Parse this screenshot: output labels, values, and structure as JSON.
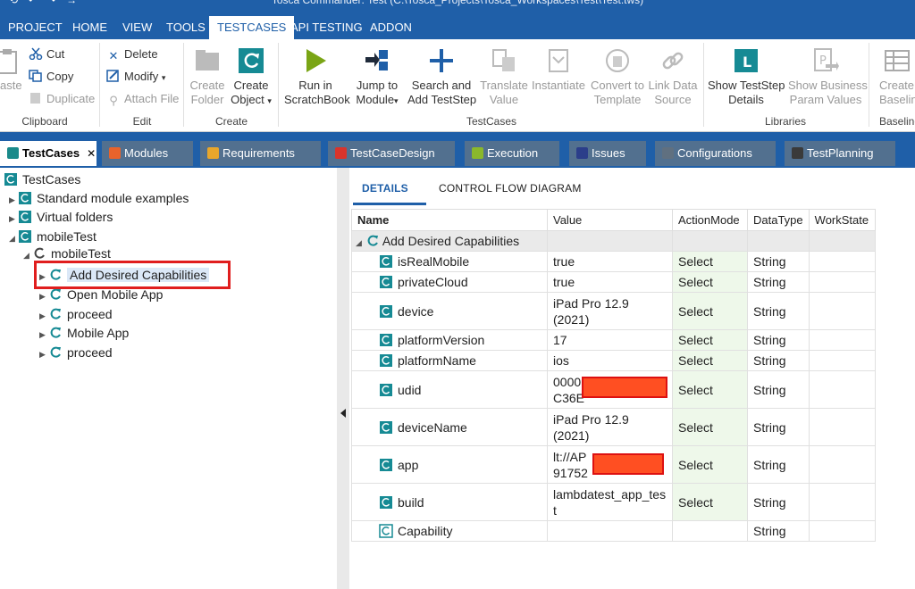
{
  "window": {
    "title": "Tosca Commander: Test (C:\\Tosca_Projects\\Tosca_Workspaces\\Test\\Test.tws)"
  },
  "menu": {
    "tabs": [
      "PROJECT",
      "HOME",
      "VIEW",
      "TOOLS",
      "TESTCASES",
      "API TESTING",
      "ADDON"
    ],
    "active": "TESTCASES"
  },
  "ribbon": {
    "clipboard": {
      "paste": "Paste",
      "cut": "Cut",
      "copy": "Copy",
      "duplicate": "Duplicate",
      "label": "Clipboard"
    },
    "edit": {
      "delete": "Delete",
      "modify": "Modify",
      "attach_file": "Attach File",
      "label": "Edit"
    },
    "create": {
      "folder_1": "Create",
      "folder_2": "Folder",
      "object_1": "Create",
      "object_2": "Object",
      "label": "Create"
    },
    "testcases": {
      "run_1": "Run in",
      "run_2": "ScratchBook",
      "jump_1": "Jump to",
      "jump_2": "Module",
      "search_1": "Search and",
      "search_2": "Add TestStep",
      "translate_1": "Translate",
      "translate_2": "Value",
      "instantiate": "Instantiate",
      "convert_1": "Convert to",
      "convert_2": "Template",
      "link_1": "Link Data",
      "link_2": "Source",
      "label": "TestCases"
    },
    "libraries": {
      "show_ts_1": "Show TestStep",
      "show_ts_2": "Details",
      "show_bp_1": "Show Business",
      "show_bp_2": "Param Values",
      "label": "Libraries"
    },
    "baseline": {
      "create_1": "Create",
      "create_2": "Baseline",
      "label": "Baseline"
    }
  },
  "perspective_tabs": [
    {
      "label": "TestCases",
      "color": "#1a8a8a"
    },
    {
      "label": "Modules",
      "color": "#e8632b"
    },
    {
      "label": "Requirements",
      "color": "#e8a62b"
    },
    {
      "label": "TestCaseDesign",
      "color": "#d9342b"
    },
    {
      "label": "Execution",
      "color": "#8ab82b"
    },
    {
      "label": "Issues",
      "color": "#2b3e8a"
    },
    {
      "label": "Configurations",
      "color": "#607080"
    },
    {
      "label": "TestPlanning",
      "color": "#3a3a3a"
    }
  ],
  "tree": {
    "root": "TestCases",
    "items": [
      {
        "label": "Standard module examples"
      },
      {
        "label": "Virtual folders"
      },
      {
        "label": "mobileTest"
      },
      {
        "label": "mobileTest"
      },
      {
        "label": "Add Desired Capabilities"
      },
      {
        "label": "Open Mobile App"
      },
      {
        "label": "proceed"
      },
      {
        "label": "Mobile App"
      },
      {
        "label": "proceed"
      }
    ]
  },
  "details": {
    "tab_details": "DETAILS",
    "tab_flow": "CONTROL FLOW DIAGRAM",
    "columns": {
      "name": "Name",
      "value": "Value",
      "action": "ActionMode",
      "dtype": "DataType",
      "work": "WorkState"
    },
    "group_name": "Add Desired Capabilities",
    "rows": [
      {
        "name": "isRealMobile",
        "value": "true",
        "action": "Select",
        "dtype": "String"
      },
      {
        "name": "privateCloud",
        "value": "true",
        "action": "Select",
        "dtype": "String"
      },
      {
        "name": "device",
        "value": "iPad Pro 12.9 (2021)",
        "action": "Select",
        "dtype": "String"
      },
      {
        "name": "platformVersion",
        "value": "17",
        "action": "Select",
        "dtype": "String"
      },
      {
        "name": "platformName",
        "value": "ios",
        "action": "Select",
        "dtype": "String"
      },
      {
        "name": "udid",
        "value": "0000",
        "value2": "C36E",
        "action": "Select",
        "dtype": "String"
      },
      {
        "name": "deviceName",
        "value": "iPad Pro 12.9 (2021)",
        "action": "Select",
        "dtype": "String"
      },
      {
        "name": "app",
        "value": "lt://AP",
        "value2": "91752",
        "action": "Select",
        "dtype": "String"
      },
      {
        "name": "build",
        "value": "lambdatest_app_test",
        "action": "Select",
        "dtype": "String"
      },
      {
        "name": "Capability",
        "value": "",
        "action": "",
        "dtype": "String"
      }
    ]
  },
  "colors": {
    "brand": "#1f5fa8",
    "highlight": "#e01e1e",
    "redaction": "#ff4f22"
  }
}
